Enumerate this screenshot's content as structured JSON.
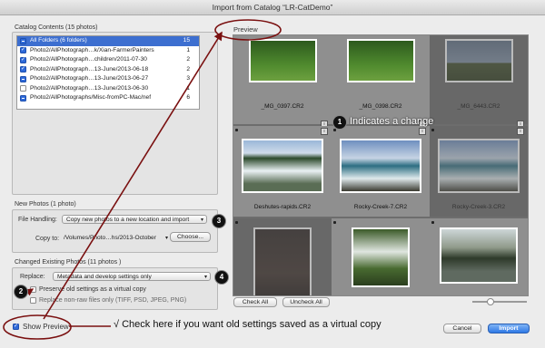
{
  "window": {
    "title": "Import from Catalog “LR-CatDemo”"
  },
  "catalog": {
    "heading": "Catalog Contents (15 photos)",
    "rows": [
      {
        "path": "All Folders (6 folders)",
        "count": "15",
        "state": "mixed",
        "selected": true
      },
      {
        "path": "Photo2/AllPhotograph…k/Xian-FarmerPainters",
        "count": "1",
        "state": "checked"
      },
      {
        "path": "Photo2/AllPhotograph…children/2011-07-30",
        "count": "2",
        "state": "checked"
      },
      {
        "path": "Photo2/AllPhotograph…13-June/2013-06-18",
        "count": "2",
        "state": "checked"
      },
      {
        "path": "Photo2/AllPhotograph…13-June/2013-06-27",
        "count": "3",
        "state": "mixed"
      },
      {
        "path": "Photo2/AllPhotograph…13-June/2013-06-30",
        "count": "1",
        "state": "empty"
      },
      {
        "path": "Photo2/AllPhotographs/Misc-fromPC-Mac/nef",
        "count": "6",
        "state": "mixed"
      }
    ]
  },
  "new_photos": {
    "heading": "New Photos (1 photo)",
    "file_handling_label": "File Handling:",
    "file_handling_value": "Copy new photos to a new location and import",
    "copy_to_label": "Copy to:",
    "copy_to_value": "/Volumes/Photo…hs/2013-October",
    "choose_label": "Choose..."
  },
  "changed": {
    "heading": "Changed Existing Photos (11 photos )",
    "replace_label": "Replace:",
    "replace_value": "Metadata and develop settings only",
    "opt1": "Preserve old settings as a virtual copy",
    "opt2": "Replace non-raw files only (TIFF, PSD, JPEG, PNG)"
  },
  "show_preview_label": "Show Preview",
  "preview": {
    "heading": "Preview",
    "check_all": "Check All",
    "uncheck_all": "Uncheck All",
    "thumbs": [
      {
        "caption": "_MG_0397.CR2",
        "scene": "grass",
        "state": "lit"
      },
      {
        "caption": "_MG_0398.CR2",
        "scene": "grass",
        "state": "lit"
      },
      {
        "caption": "_MG_6443.CR2",
        "scene": "church",
        "state": "dim"
      },
      {
        "caption": "Deshutes-rapids.CR2",
        "scene": "rapids",
        "state": "lit"
      },
      {
        "caption": "Rocky-Creek-7.CR2",
        "scene": "sea",
        "state": "lit"
      },
      {
        "caption": "Rocky-Creek-3.CR2",
        "scene": "sea",
        "state": "dim"
      },
      {
        "caption": "",
        "scene": "dark",
        "state": "dim"
      },
      {
        "caption": "",
        "scene": "falls",
        "state": "lit"
      },
      {
        "caption": "",
        "scene": "lake",
        "state": "lit"
      }
    ]
  },
  "footer": {
    "cancel": "Cancel",
    "import": "Import"
  },
  "annotations": {
    "n1": "1",
    "n2": "2",
    "n3": "3",
    "n4": "4",
    "note1": "Indicates a change",
    "note2": "√ Check here if you want old settings saved as a virtual copy"
  },
  "colors": {
    "accent": "#3d6fd0",
    "annotation": "#7a1010"
  }
}
